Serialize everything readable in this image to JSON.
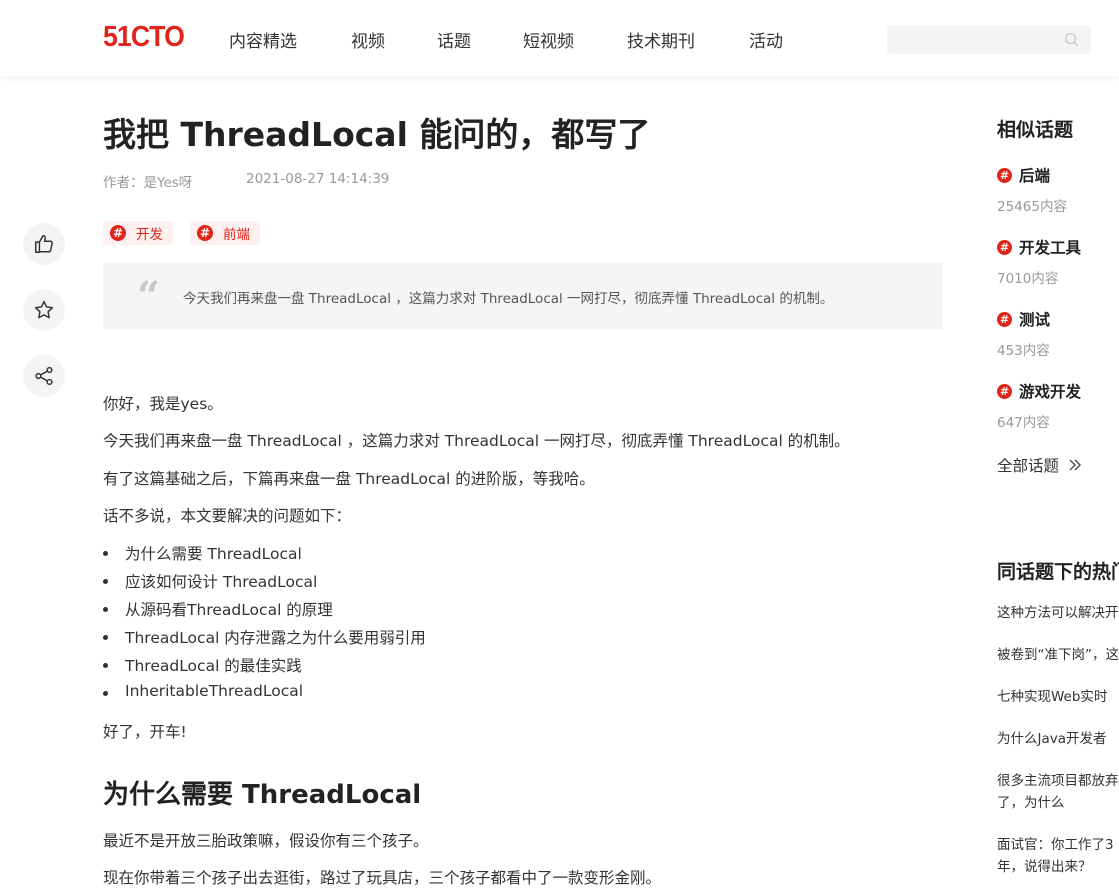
{
  "header": {
    "logo": "51CTO",
    "nav": [
      "内容精选",
      "视频",
      "话题",
      "短视频",
      "技术期刊",
      "活动"
    ],
    "search_placeholder": ""
  },
  "toolbar": {
    "icons": [
      "thumbs-up-icon",
      "star-icon",
      "share-icon"
    ]
  },
  "article": {
    "title": "我把 ThreadLocal 能问的，都写了",
    "author": "作者：是Yes呀",
    "date": "2021-08-27 14:14:39",
    "tags": [
      "开发",
      "前端"
    ],
    "summary": "今天我们再来盘一盘 ThreadLocal ，这篇力求对 ThreadLocal 一网打尽，彻底弄懂 ThreadLocal 的机制。",
    "paragraphs": [
      "你好，我是yes。",
      "今天我们再来盘一盘 ThreadLocal ，这篇力求对 ThreadLocal 一网打尽，彻底弄懂 ThreadLocal 的机制。",
      "有了这篇基础之后，下篇再来盘一盘 ThreadLocal 的进阶版，等我哈。",
      "话不多说，本文要解决的问题如下："
    ],
    "bullets": [
      "为什么需要 ThreadLocal",
      "应该如何设计 ThreadLocal",
      "从源码看ThreadLocal 的原理",
      "ThreadLocal 内存泄露之为什么要用弱引用",
      "ThreadLocal 的最佳实践",
      "InheritableThreadLocal"
    ],
    "after_list": "好了，开车!",
    "section_heading": "为什么需要 ThreadLocal",
    "section_paragraphs": [
      "最近不是开放三胎政策嘛，假设你有三个孩子。",
      "现在你带着三个孩子出去逛街，路过了玩具店，三个孩子都看中了一款变形金刚。"
    ]
  },
  "sidebar": {
    "related_title": "相似话题",
    "topics": [
      {
        "name": "后端",
        "count": "25465内容"
      },
      {
        "name": "开发工具",
        "count": "7010内容"
      },
      {
        "name": "测试",
        "count": "453内容"
      },
      {
        "name": "游戏开发",
        "count": "647内容"
      }
    ],
    "all_topics": "全部话题",
    "hot_title": "同话题下的热门内容",
    "hot_items": [
      "这种方法可以解决开发中的问题",
      "被卷到“准下岗”，这",
      "七种实现Web实时消息推送的方案",
      "为什么Java开发者的",
      "很多主流项目都放弃了，为什么",
      "面试官：你工作了3年，说得出来？"
    ]
  },
  "colors": {
    "brand": "#e1251b",
    "tag_bg": "#fdf0ef",
    "summary_bg": "#f5f5f6",
    "muted_text": "#999999"
  }
}
